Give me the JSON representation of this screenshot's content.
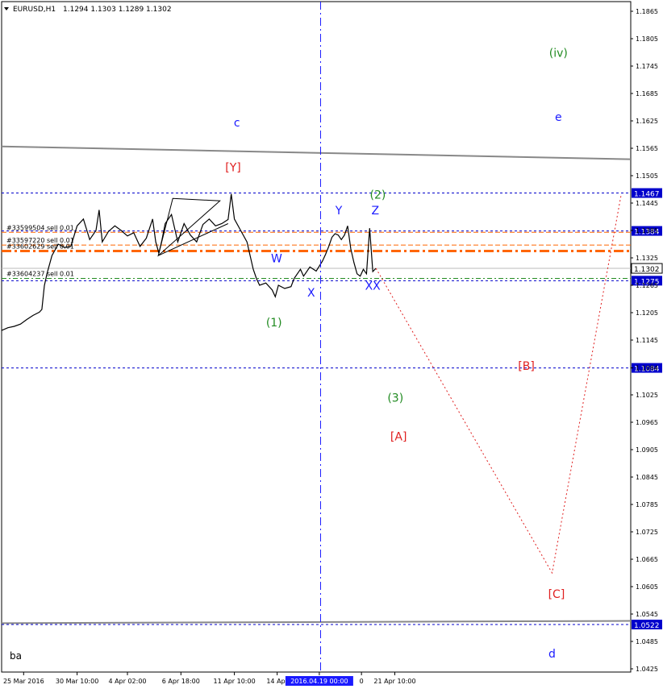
{
  "header": {
    "symbol": "EURUSD,H1",
    "ohlc": "1.1294 1.1303 1.1289 1.1302"
  },
  "footer_label": "ba",
  "colors": {
    "background": "#ffffff",
    "price": "#000000",
    "wave_blue": "#1a1aff",
    "wave_green": "#228b22",
    "wave_red": "#e02020",
    "order_orange": "#ff6600",
    "channel_gray": "#888888",
    "level_blue": "#0000cc"
  },
  "chart_data": {
    "type": "line",
    "symbol": "EURUSD",
    "timeframe": "H1",
    "ylim": [
      1.0425,
      1.1865
    ],
    "y_ticks": [
      "1.1865",
      "1.1805",
      "1.1745",
      "1.1685",
      "1.1625",
      "1.1565",
      "1.1505",
      "1.1445",
      "1.1385",
      "1.1325",
      "1.1265",
      "1.1205",
      "1.1145",
      "1.1084",
      "1.1025",
      "1.0965",
      "1.0905",
      "1.0845",
      "1.0785",
      "1.0725",
      "1.0665",
      "1.0605",
      "1.0545",
      "1.0485",
      "1.0425"
    ],
    "x_ticks": [
      "25 Mar 2016",
      "30 Mar 10:00",
      "4 Apr 02:00",
      "6 Apr 18:00",
      "11 Apr 10:00",
      "14 Apr",
      "2016.04.19 00:00",
      "0",
      "21 Apr 10:00"
    ],
    "x_ticks_pos": [
      0.035,
      0.12,
      0.2,
      0.285,
      0.37,
      0.438,
      0.505,
      0.572,
      0.625
    ],
    "price_series": [
      [
        0.0,
        1.1166
      ],
      [
        0.01,
        1.1172
      ],
      [
        0.02,
        1.1175
      ],
      [
        0.03,
        1.118
      ],
      [
        0.04,
        1.119
      ],
      [
        0.05,
        1.1199
      ],
      [
        0.06,
        1.1206
      ],
      [
        0.064,
        1.1212
      ],
      [
        0.068,
        1.1264
      ],
      [
        0.072,
        1.129
      ],
      [
        0.08,
        1.133
      ],
      [
        0.09,
        1.1355
      ],
      [
        0.1,
        1.1348
      ],
      [
        0.11,
        1.135
      ],
      [
        0.12,
        1.1395
      ],
      [
        0.13,
        1.141
      ],
      [
        0.14,
        1.1365
      ],
      [
        0.15,
        1.1385
      ],
      [
        0.155,
        1.143
      ],
      [
        0.16,
        1.136
      ],
      [
        0.17,
        1.1383
      ],
      [
        0.18,
        1.1395
      ],
      [
        0.19,
        1.1385
      ],
      [
        0.2,
        1.1373
      ],
      [
        0.21,
        1.138
      ],
      [
        0.22,
        1.135
      ],
      [
        0.23,
        1.1368
      ],
      [
        0.24,
        1.141
      ],
      [
        0.245,
        1.136
      ],
      [
        0.25,
        1.1335
      ],
      [
        0.255,
        1.1365
      ],
      [
        0.26,
        1.14
      ],
      [
        0.27,
        1.142
      ],
      [
        0.28,
        1.136
      ],
      [
        0.29,
        1.14
      ],
      [
        0.3,
        1.1375
      ],
      [
        0.31,
        1.136
      ],
      [
        0.32,
        1.1398
      ],
      [
        0.33,
        1.141
      ],
      [
        0.34,
        1.1395
      ],
      [
        0.35,
        1.14
      ],
      [
        0.36,
        1.1409
      ],
      [
        0.365,
        1.1465
      ],
      [
        0.37,
        1.141
      ],
      [
        0.38,
        1.1385
      ],
      [
        0.39,
        1.136
      ],
      [
        0.4,
        1.13
      ],
      [
        0.405,
        1.128
      ],
      [
        0.41,
        1.1265
      ],
      [
        0.42,
        1.127
      ],
      [
        0.43,
        1.1255
      ],
      [
        0.435,
        1.124
      ],
      [
        0.44,
        1.1265
      ],
      [
        0.45,
        1.1258
      ],
      [
        0.46,
        1.1262
      ],
      [
        0.465,
        1.128
      ],
      [
        0.475,
        1.13
      ],
      [
        0.48,
        1.1285
      ],
      [
        0.49,
        1.1305
      ],
      [
        0.5,
        1.1296
      ],
      [
        0.51,
        1.1318
      ],
      [
        0.515,
        1.1333
      ],
      [
        0.52,
        1.135
      ],
      [
        0.525,
        1.137
      ],
      [
        0.53,
        1.1378
      ],
      [
        0.535,
        1.1375
      ],
      [
        0.54,
        1.1365
      ],
      [
        0.545,
        1.1375
      ],
      [
        0.55,
        1.1395
      ],
      [
        0.555,
        1.1345
      ],
      [
        0.56,
        1.1315
      ],
      [
        0.565,
        1.129
      ],
      [
        0.57,
        1.1285
      ],
      [
        0.575,
        1.13
      ],
      [
        0.58,
        1.129
      ],
      [
        0.585,
        1.139
      ],
      [
        0.59,
        1.1295
      ],
      [
        0.595,
        1.1302
      ]
    ],
    "projection": [
      [
        0.595,
        1.1302
      ],
      [
        0.875,
        1.0635
      ],
      [
        0.985,
        1.1465
      ]
    ],
    "h_levels": [
      {
        "price": 1.1467,
        "label": "1.1467",
        "style": "dashed",
        "color": "#0000cc"
      },
      {
        "price": 1.1384,
        "label": "1.1384",
        "style": "dashed",
        "color": "#0000cc"
      },
      {
        "price": 1.1302,
        "label": "1.1302",
        "style": "current",
        "color": "#000000"
      },
      {
        "price": 1.1275,
        "label": "1.1275",
        "style": "dashed",
        "color": "#0000cc"
      },
      {
        "price": 1.1084,
        "label": "1.1084",
        "style": "dashed",
        "color": "#0000cc"
      },
      {
        "price": 1.0522,
        "label": "1.0522",
        "style": "dashed",
        "color": "#0000cc"
      }
    ],
    "orders": [
      {
        "id": "#33599504 sell 0.01",
        "price": 1.1381,
        "style": "thin",
        "color": "#ff6600"
      },
      {
        "id": "#33597220 sell 0.01",
        "price": 1.1353,
        "style": "thin",
        "color": "#ff6600"
      },
      {
        "id": "#33602629 sell 0.01",
        "price": 1.134,
        "style": "bold",
        "color": "#ff6600"
      },
      {
        "id": "#33604237 sell 0.01",
        "price": 1.128,
        "style": "green",
        "color": "#228b22"
      }
    ],
    "channel_lines": [
      {
        "from": [
          0.0,
          1.1569
        ],
        "to": [
          1.0,
          1.1541
        ],
        "color": "#888888"
      },
      {
        "from": [
          0.0,
          1.0525
        ],
        "to": [
          1.0,
          1.053
        ],
        "color": "#888888"
      }
    ],
    "vertical_marker": {
      "x": 0.507,
      "style": "dashdot",
      "color": "#1a1aff"
    },
    "wave_labels": [
      {
        "text": "(iv)",
        "x": 0.885,
        "price": 1.1765,
        "color": "#228b22"
      },
      {
        "text": "e",
        "x": 0.885,
        "price": 1.1625,
        "color": "#1a1aff"
      },
      {
        "text": "c",
        "x": 0.374,
        "price": 1.1613,
        "color": "#1a1aff"
      },
      {
        "text": "[Y]",
        "x": 0.368,
        "price": 1.1515,
        "color": "#e02020"
      },
      {
        "text": "(2)",
        "x": 0.598,
        "price": 1.1455,
        "color": "#228b22"
      },
      {
        "text": "Y",
        "x": 0.536,
        "price": 1.142,
        "color": "#1a1aff"
      },
      {
        "text": "Z",
        "x": 0.594,
        "price": 1.142,
        "color": "#1a1aff"
      },
      {
        "text": "W",
        "x": 0.437,
        "price": 1.1315,
        "color": "#1a1aff"
      },
      {
        "text": "X",
        "x": 0.492,
        "price": 1.124,
        "color": "#1a1aff"
      },
      {
        "text": "XX",
        "x": 0.59,
        "price": 1.1255,
        "color": "#1a1aff"
      },
      {
        "text": "(1)",
        "x": 0.433,
        "price": 1.1175,
        "color": "#228b22"
      },
      {
        "text": "(3)",
        "x": 0.626,
        "price": 1.101,
        "color": "#228b22"
      },
      {
        "text": "[B]",
        "x": 0.834,
        "price": 1.108,
        "color": "#e02020"
      },
      {
        "text": "[A]",
        "x": 0.631,
        "price": 1.0925,
        "color": "#e02020"
      },
      {
        "text": "[C]",
        "x": 0.882,
        "price": 1.058,
        "color": "#e02020"
      },
      {
        "text": "d",
        "x": 0.875,
        "price": 1.045,
        "color": "#1a1aff"
      }
    ],
    "triangles": [
      [
        [
          0.272,
          1.1455
        ],
        [
          0.347,
          1.145
        ],
        [
          0.249,
          1.133
        ]
      ],
      [
        [
          0.249,
          1.133
        ],
        [
          0.36,
          1.14
        ]
      ]
    ],
    "grid": false
  }
}
